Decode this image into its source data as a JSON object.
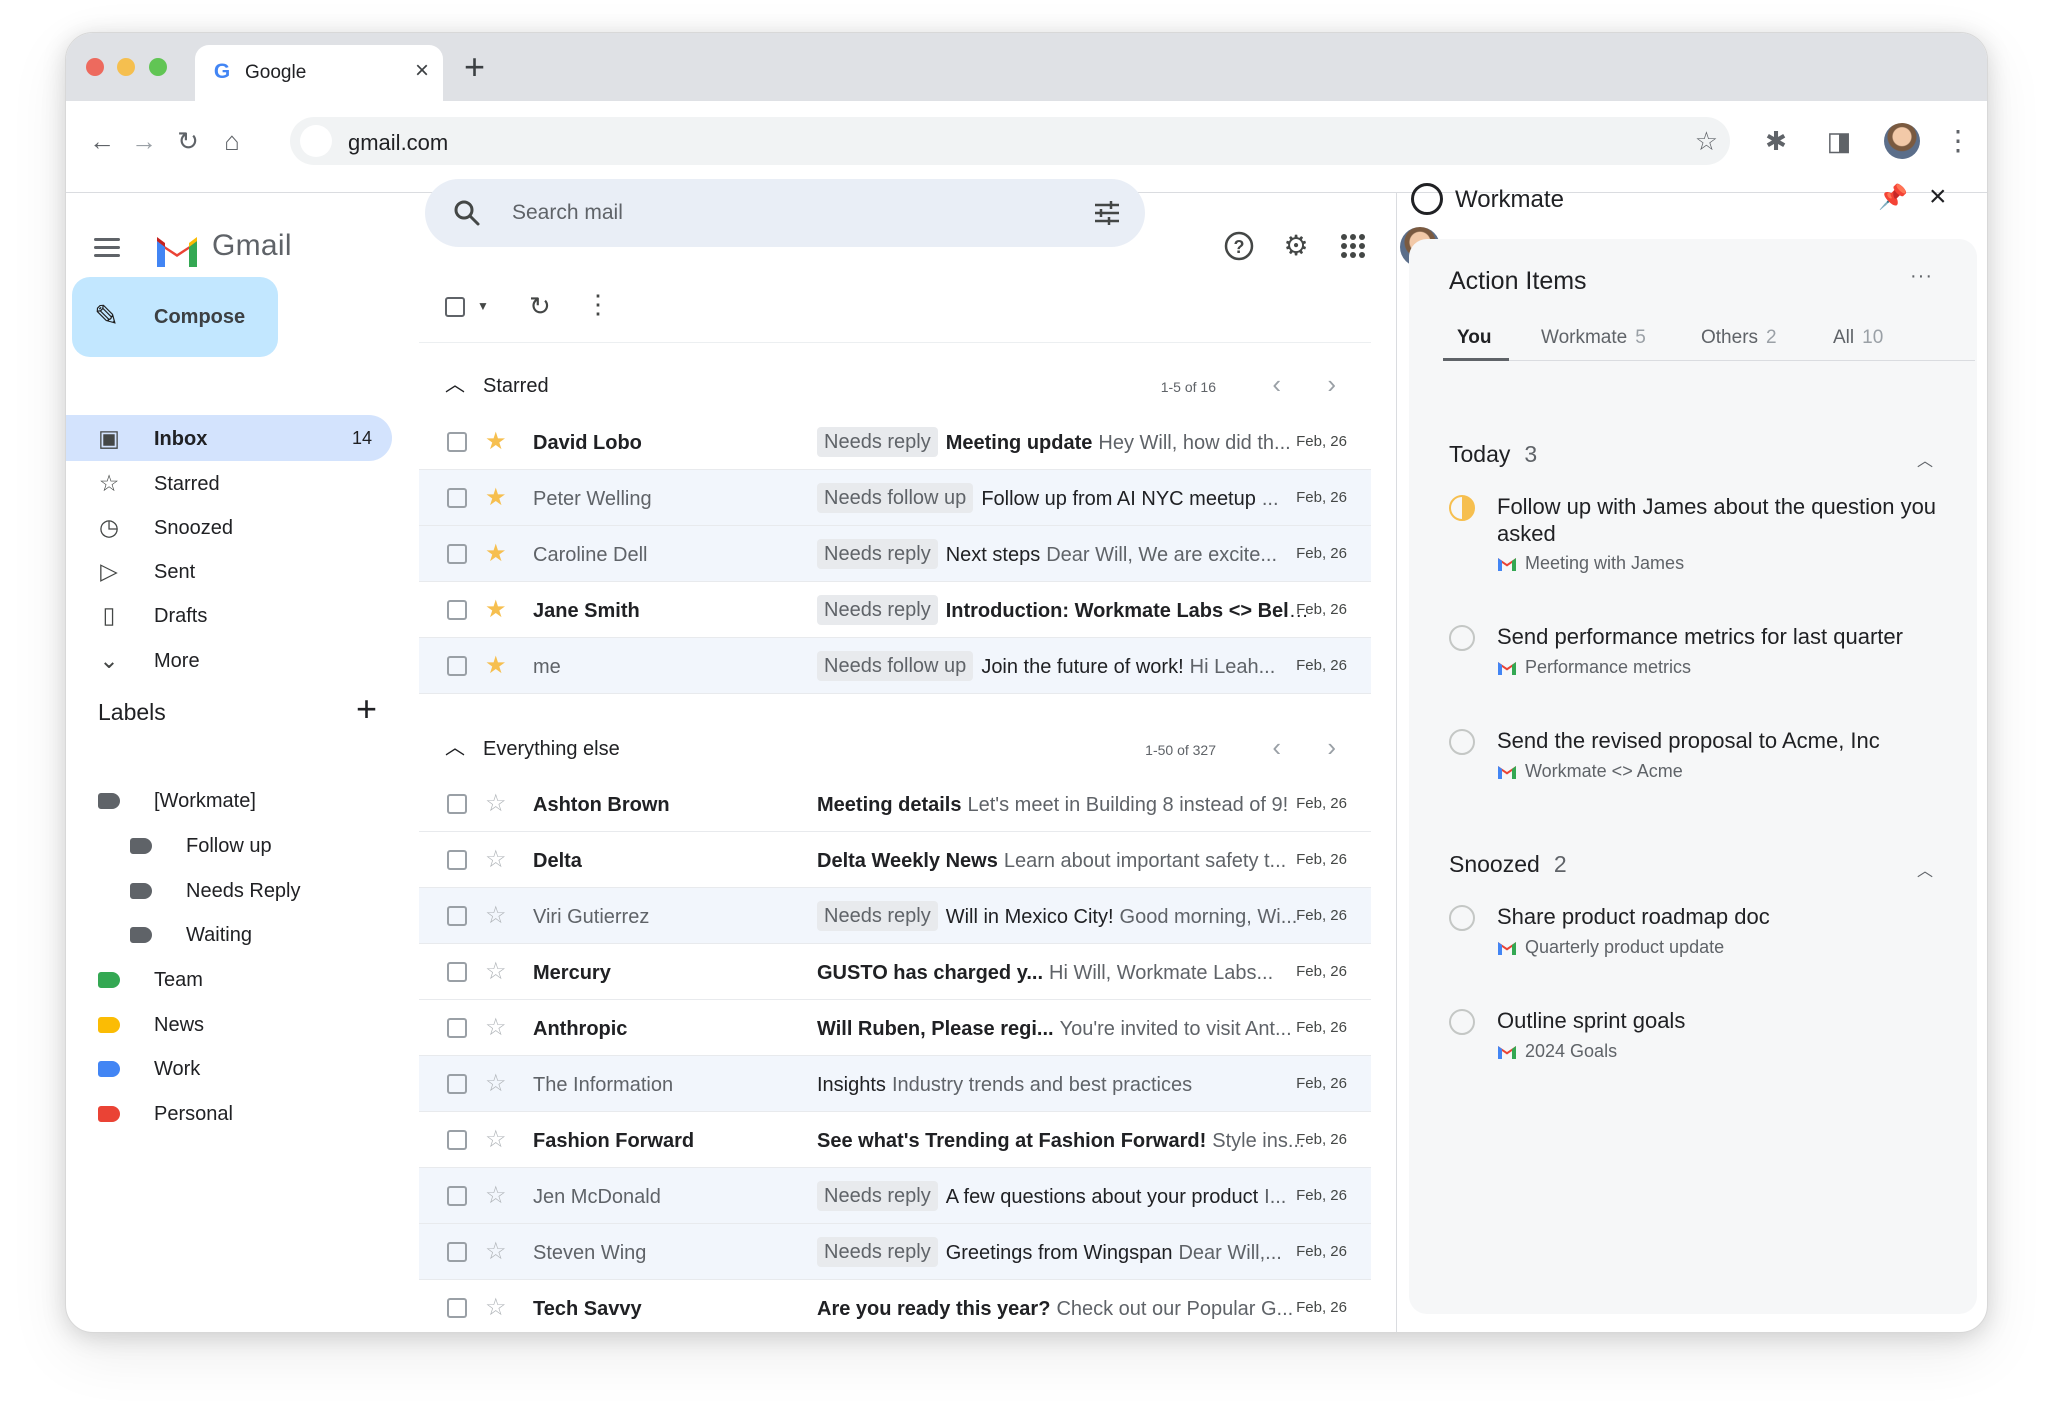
{
  "browser": {
    "tab_title": "Google",
    "tab_favicon": "G",
    "url": "gmail.com"
  },
  "gmail": {
    "brand": "Gmail",
    "compose_label": "Compose",
    "search_placeholder": "Search mail",
    "nav": [
      {
        "label": "Inbox",
        "count": "14",
        "icon": "inbox-icon"
      },
      {
        "label": "Starred",
        "count": "",
        "icon": "star-icon"
      },
      {
        "label": "Snoozed",
        "count": "",
        "icon": "clock-icon"
      },
      {
        "label": "Sent",
        "count": "",
        "icon": "send-icon"
      },
      {
        "label": "Drafts",
        "count": "",
        "icon": "draft-icon"
      },
      {
        "label": "More",
        "count": "",
        "icon": "chevron-down-icon"
      }
    ],
    "labels_heading": "Labels",
    "labels": [
      {
        "name": "[Workmate]",
        "color": "#5f6368"
      },
      {
        "name": "Follow up",
        "color": "#5f6368"
      },
      {
        "name": "Needs Reply",
        "color": "#5f6368"
      },
      {
        "name": "Waiting",
        "color": "#5f6368"
      },
      {
        "name": "Team",
        "color": "#34a853"
      },
      {
        "name": "News",
        "color": "#fbbc04"
      },
      {
        "name": "Work",
        "color": "#4285f4"
      },
      {
        "name": "Personal",
        "color": "#ea4335"
      }
    ],
    "starred_section": {
      "title": "Starred",
      "count": "1-5 of 16",
      "rows": [
        {
          "sender": "David Lobo",
          "chip": "Needs reply",
          "subject": "Meeting update",
          "snippet": "Hey Will, how did th...",
          "date": "Feb, 26",
          "unread": true,
          "starred": true
        },
        {
          "sender": "Peter Welling",
          "chip": "Needs follow up",
          "subject": "Follow up from AI NYC meetup",
          "snippet": "...",
          "date": "Feb, 26",
          "unread": false,
          "starred": true
        },
        {
          "sender": "Caroline Dell",
          "chip": "Needs reply",
          "subject": "Next steps",
          "snippet": "Dear Will, We are excite...",
          "date": "Feb, 26",
          "unread": false,
          "starred": true
        },
        {
          "sender": "Jane Smith",
          "chip": "Needs reply",
          "subject": "Introduction: Workmate Labs <> Beluga",
          "snippet": "",
          "date": "Feb, 26",
          "unread": true,
          "starred": true
        },
        {
          "sender": "me",
          "chip": "Needs follow up",
          "subject": "Join the future of work!",
          "snippet": "Hi Leah...",
          "date": "Feb, 26",
          "unread": false,
          "starred": true
        }
      ]
    },
    "else_section": {
      "title": "Everything else",
      "count": "1-50 of 327",
      "rows": [
        {
          "sender": "Ashton Brown",
          "chip": "",
          "subject": "Meeting details",
          "snippet": "Let's meet in Building 8 instead of 9!",
          "date": "Feb, 26",
          "unread": true,
          "starred": false
        },
        {
          "sender": "Delta",
          "chip": "",
          "subject": "Delta Weekly News",
          "snippet": "Learn about important safety t...",
          "date": "Feb, 26",
          "unread": true,
          "starred": false
        },
        {
          "sender": "Viri Gutierrez",
          "chip": "Needs reply",
          "subject": "Will in Mexico City!",
          "snippet": "Good morning, Wi...",
          "date": "Feb, 26",
          "unread": false,
          "starred": false
        },
        {
          "sender": "Mercury",
          "chip": "",
          "subject": "GUSTO has charged y...",
          "snippet": "Hi Will, Workmate Labs...",
          "date": "Feb, 26",
          "unread": true,
          "starred": false
        },
        {
          "sender": "Anthropic",
          "chip": "",
          "subject": "Will Ruben, Please regi...",
          "snippet": "You're invited to visit Ant...",
          "date": "Feb, 26",
          "unread": true,
          "starred": false
        },
        {
          "sender": "The Information",
          "chip": "",
          "subject": "Insights",
          "snippet": "Industry trends and best practices",
          "date": "Feb, 26",
          "unread": false,
          "starred": false
        },
        {
          "sender": "Fashion Forward",
          "chip": "",
          "subject": "See what's Trending at Fashion Forward!",
          "snippet": "Style ins...",
          "date": "Feb, 26",
          "unread": true,
          "starred": false
        },
        {
          "sender": "Jen McDonald",
          "chip": "Needs reply",
          "subject": "A few questions about your product",
          "snippet": "I...",
          "date": "Feb, 26",
          "unread": false,
          "starred": false
        },
        {
          "sender": "Steven Wing",
          "chip": "Needs reply",
          "subject": "Greetings from Wingspan",
          "snippet": "Dear Will,...",
          "date": "Feb, 26",
          "unread": false,
          "starred": false
        },
        {
          "sender": "Tech Savvy",
          "chip": "",
          "subject": "Are you ready this year?",
          "snippet": "Check out our Popular G...",
          "date": "Feb, 26",
          "unread": true,
          "starred": false
        }
      ]
    }
  },
  "workmate": {
    "title": "Workmate",
    "card_title": "Action Items",
    "tabs": [
      {
        "label": "You",
        "count": ""
      },
      {
        "label": "Workmate",
        "count": "5"
      },
      {
        "label": "Others",
        "count": "2"
      },
      {
        "label": "All",
        "count": "10"
      }
    ],
    "groups": [
      {
        "title": "Today",
        "count": "3",
        "tasks": [
          {
            "text": "Follow up with James about the question you asked",
            "source": "Meeting with James",
            "in_progress": true
          },
          {
            "text": "Send performance metrics for last quarter",
            "source": "Performance metrics",
            "in_progress": false
          },
          {
            "text": "Send the revised proposal to Acme, Inc",
            "source": "Workmate <> Acme",
            "in_progress": false
          }
        ]
      },
      {
        "title": "Snoozed",
        "count": "2",
        "tasks": [
          {
            "text": "Share product roadmap doc",
            "source": "Quarterly product update",
            "in_progress": false
          },
          {
            "text": "Outline sprint goals",
            "source": "2024 Goals",
            "in_progress": false
          }
        ]
      }
    ]
  }
}
